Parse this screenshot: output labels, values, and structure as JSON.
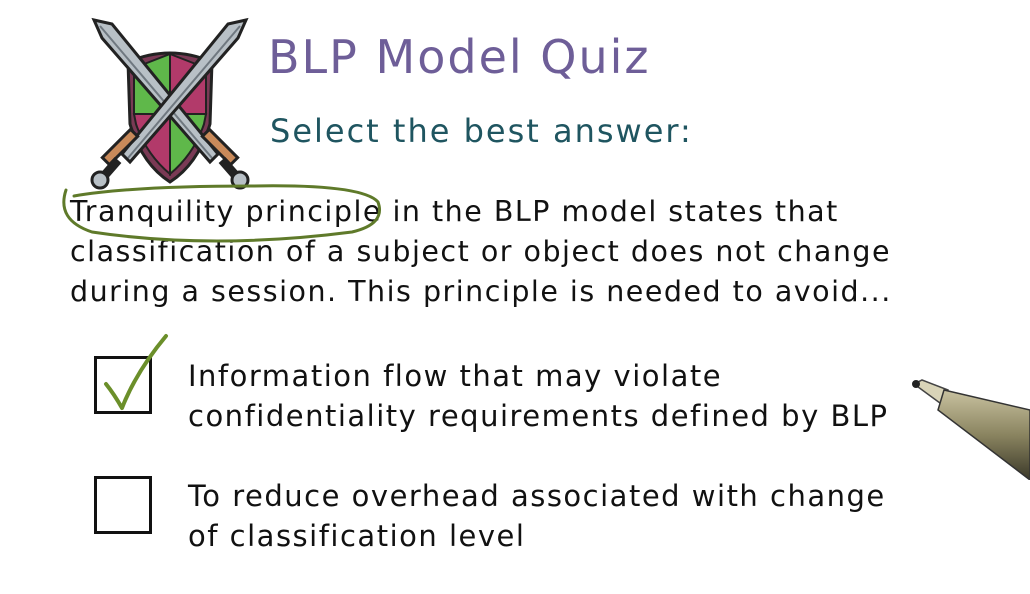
{
  "quiz": {
    "title": "BLP Model Quiz",
    "subtitle": "Select the best answer:",
    "question_lines": [
      "Tranquility principle in the BLP model states that",
      "classification of a subject or object does not change",
      "during a session. This principle is needed to avoid..."
    ],
    "highlighted_phrase": "Tranquility principle",
    "options": [
      {
        "lines": [
          "Information flow that may violate",
          "confidentiality requirements defined by BLP"
        ],
        "checked": true
      },
      {
        "lines": [
          "To reduce overhead associated with change",
          "of classification level"
        ],
        "checked": false
      }
    ]
  },
  "icons": {
    "logo": "crossed-swords-shield-icon",
    "checkmark": "checkmark-icon",
    "pen": "pen-icon"
  },
  "colors": {
    "title": "#6e5e98",
    "subtitle": "#1f5560",
    "text": "#111111",
    "highlight": "#5f7a2a",
    "checkmark": "#6b8f2a",
    "shield_green": "#5fb84a",
    "shield_pink": "#b23a6a",
    "sword_steel": "#a9b1b8"
  }
}
